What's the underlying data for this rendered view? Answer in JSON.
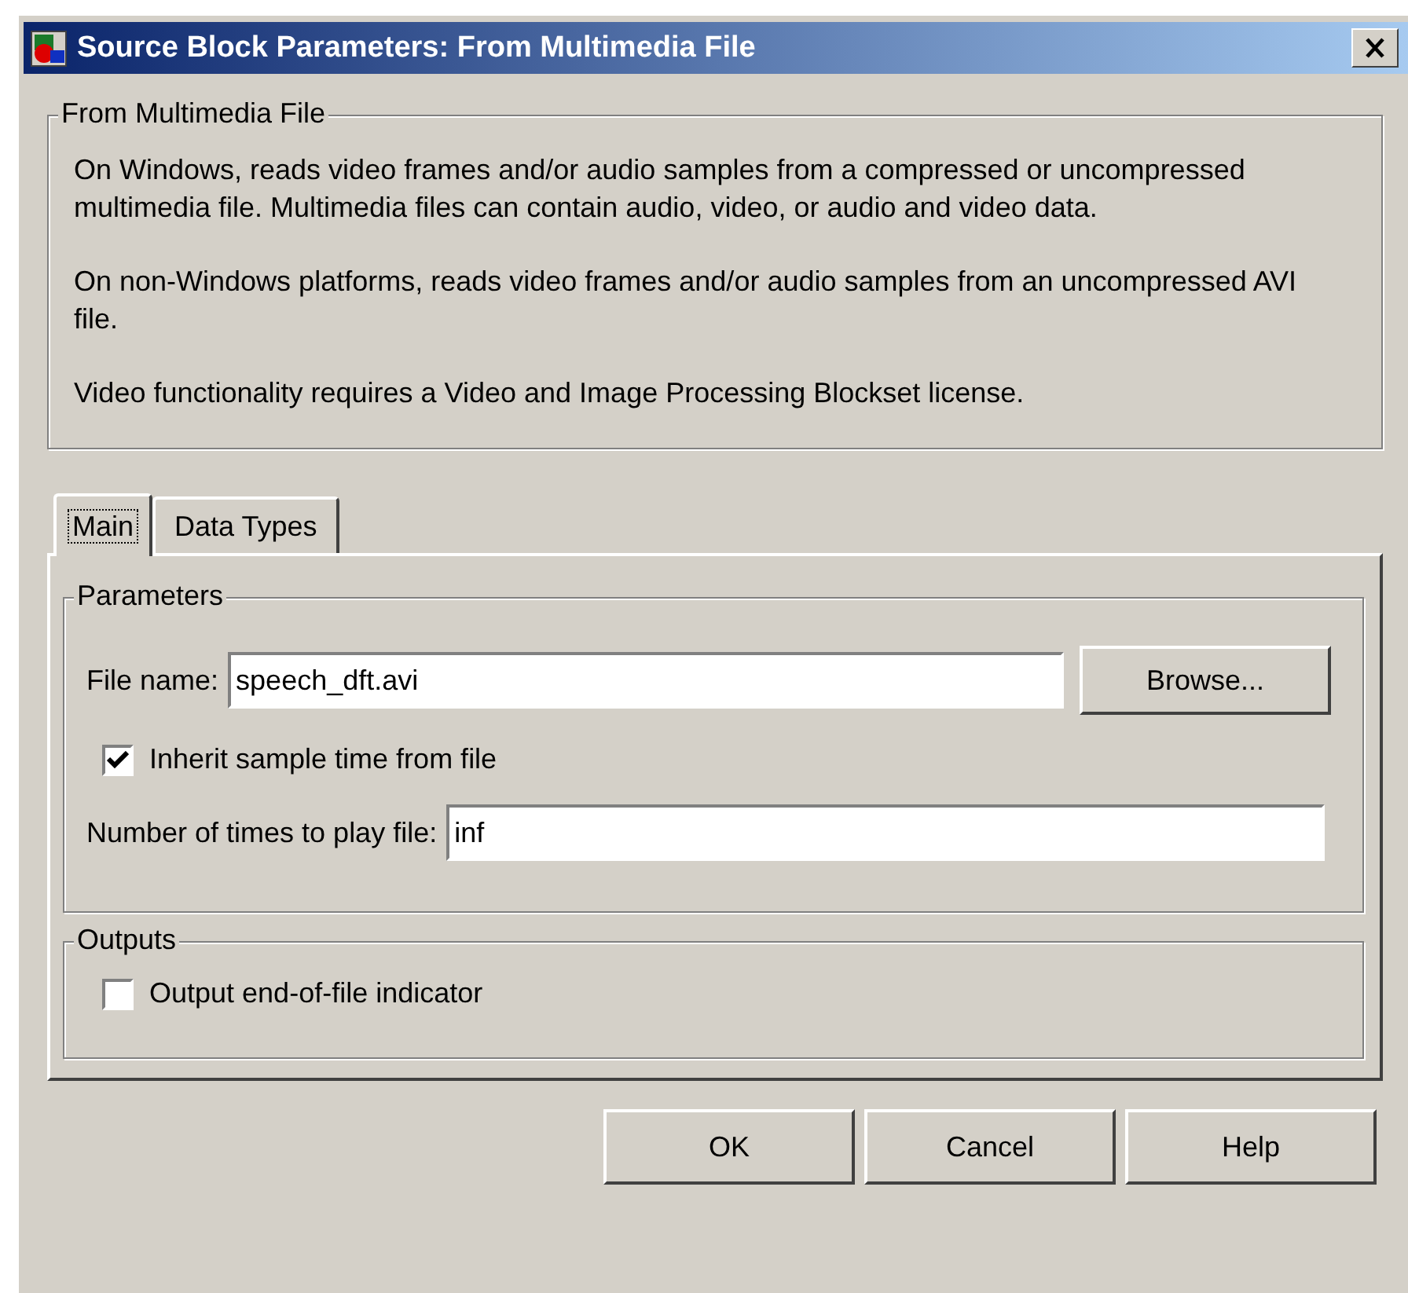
{
  "window": {
    "title": "Source Block Parameters: From Multimedia File"
  },
  "description": {
    "title": "From Multimedia File",
    "paragraphs": [
      "On Windows, reads video frames and/or audio samples from a compressed or uncompressed multimedia file. Multimedia files can contain audio, video, or audio and video data.",
      "On non-Windows platforms, reads video frames and/or audio samples from an uncompressed AVI file.",
      "Video functionality requires a Video and Image Processing Blockset license."
    ]
  },
  "tabs": [
    {
      "label": "Main",
      "selected": true
    },
    {
      "label": "Data Types",
      "selected": false
    }
  ],
  "groups": [
    {
      "title": "Parameters",
      "items": [
        {
          "kind": "file",
          "label": "File name:",
          "value": "speech_dft.avi",
          "button": "Browse..."
        },
        {
          "kind": "checkbox",
          "label": "Inherit sample time from file",
          "checked": true
        },
        {
          "kind": "text",
          "label": "Number of times to play file:",
          "value": "inf"
        }
      ]
    },
    {
      "title": "Outputs",
      "items": [
        {
          "kind": "checkbox",
          "label": "Output end-of-file indicator",
          "checked": false
        }
      ]
    }
  ],
  "buttons": [
    "OK",
    "Cancel",
    "Help"
  ]
}
